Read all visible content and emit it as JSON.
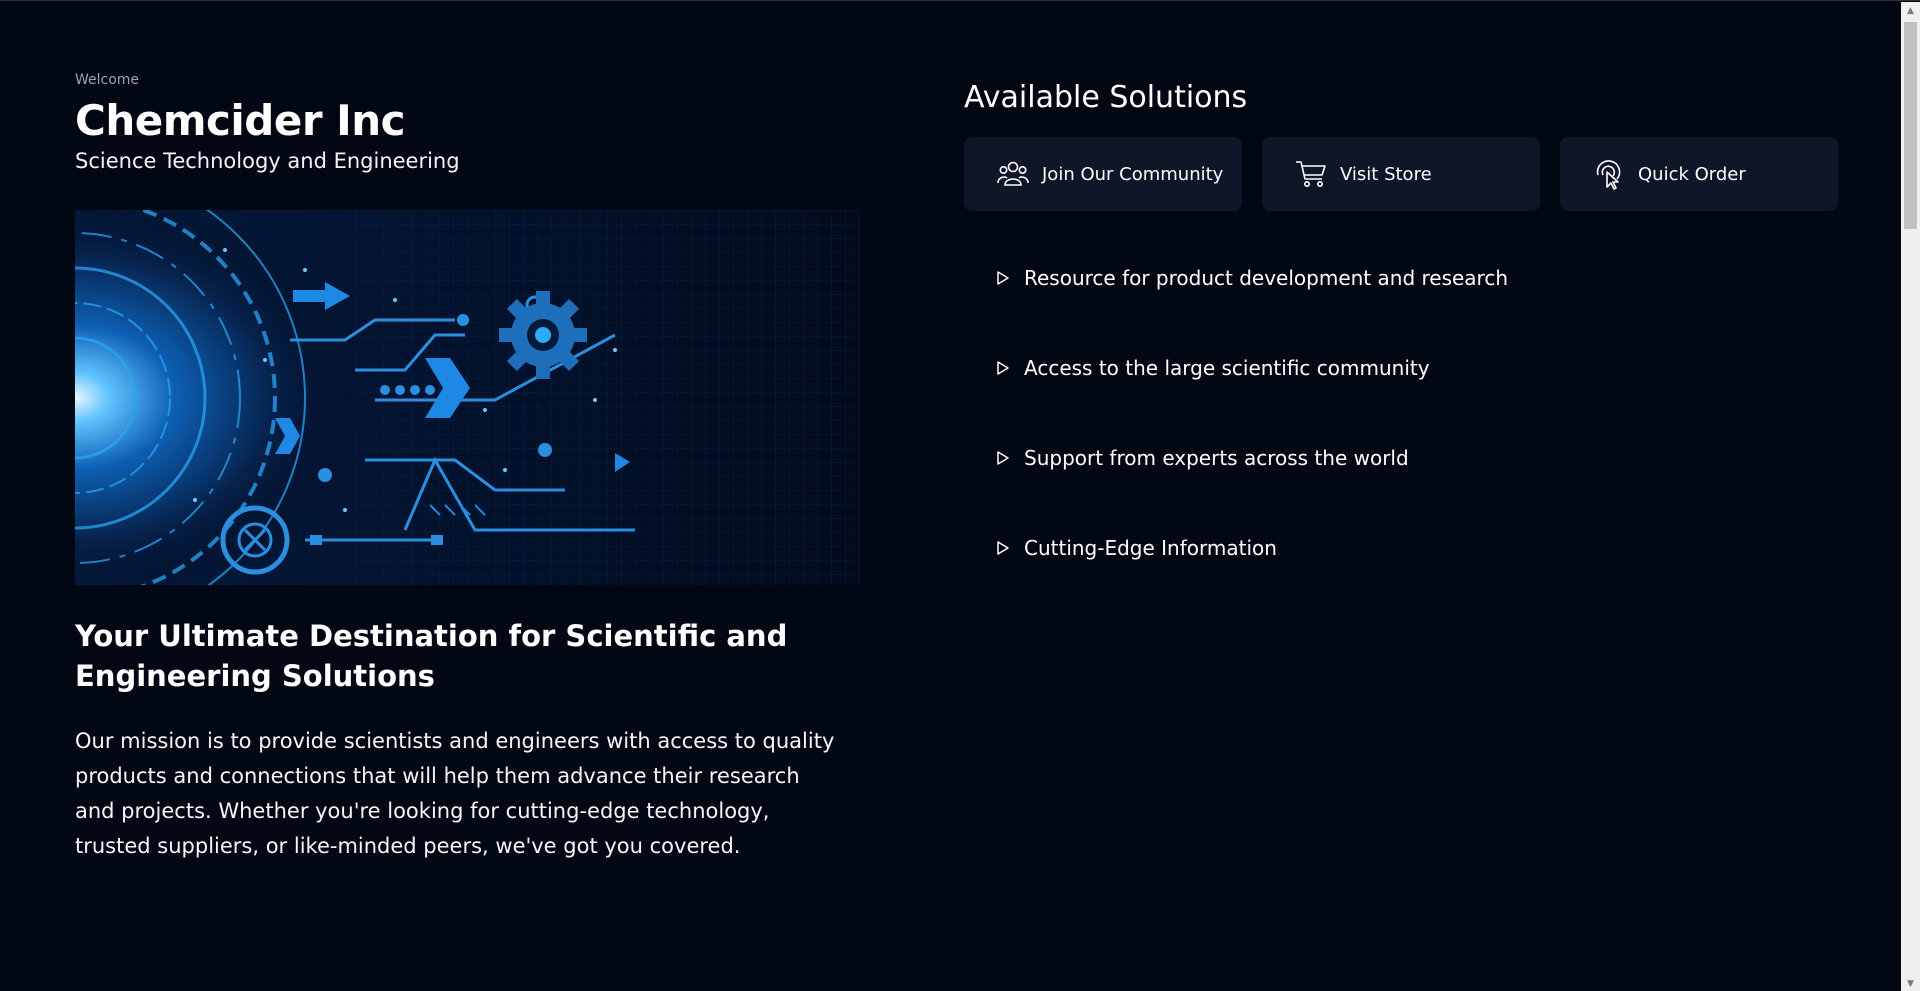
{
  "header": {
    "welcome": "Welcome",
    "company": "Chemcider Inc",
    "tagline": "Science Technology and Engineering"
  },
  "hero": {
    "headline": "Your Ultimate Destination for Scientific and Engineering Solutions",
    "mission": "Our mission is to provide scientists and engineers with access to quality products and connections that will help them advance their research and projects. Whether you're looking for cutting-edge technology, trusted suppliers, or like-minded peers, we've got you covered."
  },
  "solutions": {
    "title": "Available Solutions",
    "cards": [
      {
        "label": "Join Our Community",
        "icon": "community-icon"
      },
      {
        "label": "Visit Store",
        "icon": "cart-icon"
      },
      {
        "label": "Quick Order",
        "icon": "click-icon"
      }
    ],
    "features": [
      "Resource for product development and research",
      "Access to the large scientific community",
      "Support from experts across the world",
      "Cutting-Edge Information"
    ]
  },
  "colors": {
    "background": "#010814",
    "card": "#0e1627",
    "accent": "#1e88e5"
  }
}
